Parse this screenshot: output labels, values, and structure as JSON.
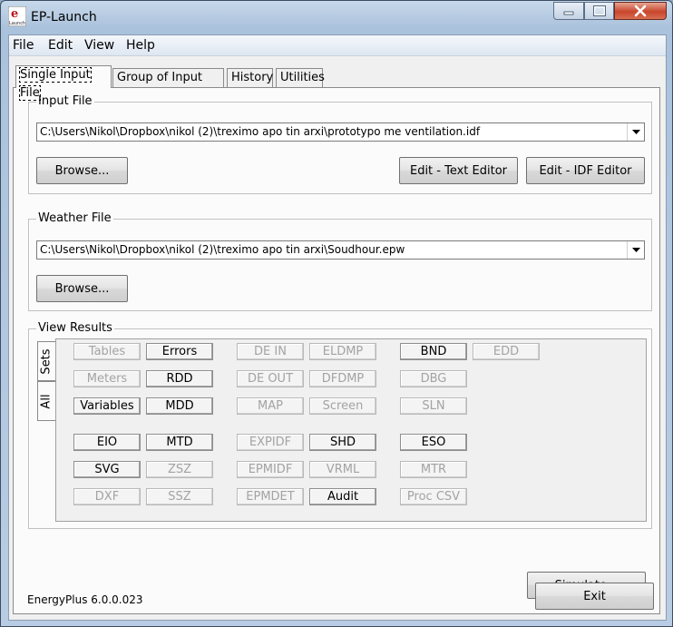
{
  "window": {
    "title": "EP-Launch",
    "icon_text": "Launch",
    "icon_letter": "e"
  },
  "menu": {
    "items": [
      "File",
      "Edit",
      "View",
      "Help"
    ]
  },
  "tabs": [
    "Single Input File",
    "Group of Input Files",
    "History",
    "Utilities"
  ],
  "input_file": {
    "legend": "Input File",
    "path": "C:\\Users\\Nikol\\Dropbox\\nikol (2)\\treximo apo tin arxi\\prototypo me ventilation.idf",
    "browse_label": "Browse...",
    "edit_text_label": "Edit - Text Editor",
    "edit_idf_label": "Edit - IDF Editor"
  },
  "weather_file": {
    "legend": "Weather File",
    "path": "C:\\Users\\Nikol\\Dropbox\\nikol (2)\\treximo apo tin arxi\\Soudhour.epw",
    "browse_label": "Browse..."
  },
  "view_results": {
    "legend": "View Results",
    "side_tabs": [
      "Sets",
      "All"
    ],
    "buttons": [
      {
        "label": "Tables",
        "enabled": false
      },
      {
        "label": "Errors",
        "enabled": true
      },
      {
        "label": "DE IN",
        "enabled": false
      },
      {
        "label": "ELDMP",
        "enabled": false
      },
      {
        "label": "BND",
        "enabled": true
      },
      {
        "label": "EDD",
        "enabled": false
      },
      {
        "label": "Meters",
        "enabled": false
      },
      {
        "label": "RDD",
        "enabled": true
      },
      {
        "label": "DE OUT",
        "enabled": false
      },
      {
        "label": "DFDMP",
        "enabled": false
      },
      {
        "label": "DBG",
        "enabled": false
      },
      {
        "label": "Variables",
        "enabled": true
      },
      {
        "label": "MDD",
        "enabled": true
      },
      {
        "label": "MAP",
        "enabled": false
      },
      {
        "label": "Screen",
        "enabled": false
      },
      {
        "label": "SLN",
        "enabled": false
      },
      {
        "label": "EIO",
        "enabled": true
      },
      {
        "label": "MTD",
        "enabled": true
      },
      {
        "label": "EXPIDF",
        "enabled": false
      },
      {
        "label": "SHD",
        "enabled": true
      },
      {
        "label": "ESO",
        "enabled": true
      },
      {
        "label": "SVG",
        "enabled": true
      },
      {
        "label": "ZSZ",
        "enabled": false
      },
      {
        "label": "EPMIDF",
        "enabled": false
      },
      {
        "label": "VRML",
        "enabled": false
      },
      {
        "label": "MTR",
        "enabled": false
      },
      {
        "label": "DXF",
        "enabled": false
      },
      {
        "label": "SSZ",
        "enabled": false
      },
      {
        "label": "EPMDET",
        "enabled": false
      },
      {
        "label": "Audit",
        "enabled": true
      },
      {
        "label": "Proc CSV",
        "enabled": false
      }
    ]
  },
  "simulate_label": "Simulate...",
  "exit_label": "Exit",
  "status_version": "EnergyPlus 6.0.0.023"
}
